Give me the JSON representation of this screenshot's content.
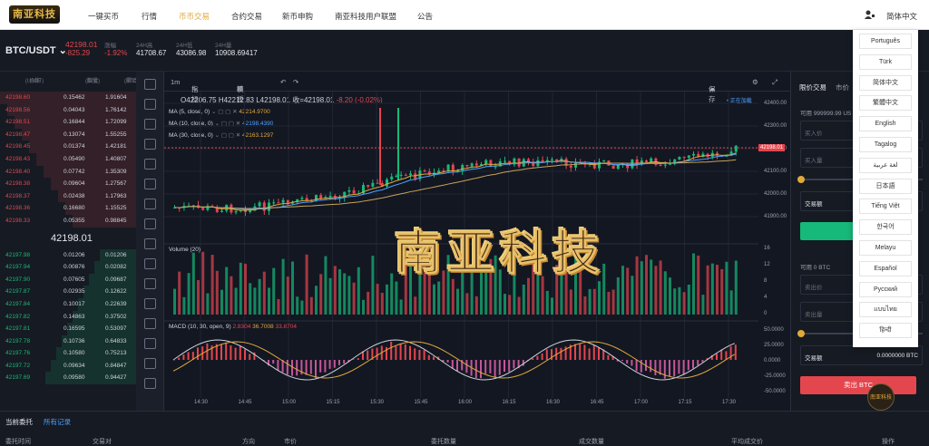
{
  "nav": {
    "logo": "南亚科技",
    "items": [
      "一键买币",
      "行情",
      "币币交易",
      "合约交易",
      "新币申购",
      "南亚科技用户联盟",
      "公告"
    ],
    "active_index": 2,
    "current_language": "简体中文"
  },
  "ticker": {
    "pair": "BTC/USDT",
    "price": "42198.01",
    "change": "-825.29",
    "pct_label": "涨幅",
    "pct": "-1.92%",
    "high_label": "24H高",
    "high": "41708.67",
    "low_label": "24H低",
    "low": "43086.98",
    "vol_label": "24H量",
    "vol": "10908.69417"
  },
  "orderbook": {
    "headers": [
      [
        "价格",
        "(USDT)"
      ],
      [
        "数量",
        "(BTC)"
      ],
      [
        "累计",
        "(BTC)"
      ]
    ],
    "asks": [
      [
        "42198.60",
        "0.15462",
        "1.91604"
      ],
      [
        "42198.56",
        "0.04043",
        "1.76142"
      ],
      [
        "42198.51",
        "0.16844",
        "1.72099"
      ],
      [
        "42198.47",
        "0.13074",
        "1.55255"
      ],
      [
        "42198.45",
        "0.01374",
        "1.42181"
      ],
      [
        "42198.43",
        "0.05490",
        "1.40807"
      ],
      [
        "42198.40",
        "0.07742",
        "1.35309"
      ],
      [
        "42198.38",
        "0.09604",
        "1.27567"
      ],
      [
        "42198.37",
        "0.02438",
        "1.17963"
      ],
      [
        "42198.36",
        "0.16680",
        "1.15525"
      ],
      [
        "42198.33",
        "0.05355",
        "0.98845"
      ]
    ],
    "mid": "42198.01",
    "bids": [
      [
        "42197.98",
        "0.01206",
        "0.01206"
      ],
      [
        "42197.94",
        "0.00876",
        "0.02082"
      ],
      [
        "42197.90",
        "0.07605",
        "0.09687"
      ],
      [
        "42197.87",
        "0.02935",
        "0.12622"
      ],
      [
        "42197.84",
        "0.10017",
        "0.22639"
      ],
      [
        "42197.82",
        "0.14863",
        "0.37502"
      ],
      [
        "42197.81",
        "0.16595",
        "0.53097"
      ],
      [
        "42197.78",
        "0.10736",
        "0.64833"
      ],
      [
        "42197.76",
        "0.10580",
        "0.75213"
      ],
      [
        "42197.72",
        "0.09634",
        "0.84847"
      ],
      [
        "42197.69",
        "0.09580",
        "0.94427"
      ]
    ]
  },
  "chart": {
    "toolbar": {
      "interval": "1m",
      "indicators": "指标",
      "template": "模板",
      "save": "保存"
    },
    "ohlc": {
      "o": "O42206.75",
      "h": "H42212.83",
      "l": "L42198.01",
      "c": "收=42198.01",
      "chg": "-8.20 (-0.02%)"
    },
    "live": "• 正在加载",
    "ma": [
      {
        "label": "MA (5, close, 0)",
        "value": "42214.9700",
        "color": "#e0a93a"
      },
      {
        "label": "MA (10, close, 0)",
        "value": "42198.4390",
        "color": "#4ea1ff"
      },
      {
        "label": "MA (30, close, 0)",
        "value": "42163.1297",
        "color": "#e0a93a"
      }
    ],
    "volume_label": "Volume (20)",
    "macd_label": "MACD (10, 30, open, 9)",
    "macd_values": [
      "2.8304",
      "36.7008",
      "33.8704"
    ],
    "price_ticks": [
      "42400.00",
      "42300.00",
      "42200.00",
      "42100.00",
      "42000.00",
      "41900.00"
    ],
    "current_price_tag": "42198.01",
    "vol_ticks": [
      "16",
      "12",
      "8",
      "4",
      "0"
    ],
    "macd_ticks": [
      "50.0000",
      "25.0000",
      "0.0000",
      "-25.0000",
      "-50.0000"
    ],
    "time_ticks": [
      "14:30",
      "14:45",
      "15:00",
      "15:15",
      "15:30",
      "15:45",
      "16:00",
      "16:15",
      "16:30",
      "16:45",
      "17:00",
      "17:15",
      "17:30"
    ],
    "watermark": "南亚科技"
  },
  "trade": {
    "tabs": [
      "限价交易",
      "市价"
    ],
    "available_label": "可用",
    "available": "999999.99 US",
    "buy_price": "买入价",
    "buy_amount": "买入量",
    "volume_label": "交易额",
    "buy_btn": "买",
    "available2": "可用  0 BTC",
    "sell_price": "卖出价",
    "sell_amount": "卖出量",
    "sell_volume_label": "交易额",
    "sell_volume": "0.0000000 BTC",
    "sell_btn": "卖出 BTC"
  },
  "languages": [
    "Português",
    "Türk",
    "简体中文",
    "繁體中文",
    "English",
    "Tagalog",
    "لغة عربية",
    "日本語",
    "Tiếng Việt",
    "한국어",
    "Melayu",
    "Español",
    "Русский",
    "แบบไทย",
    "हिन्दी"
  ],
  "bottom": {
    "tabs": [
      "当前委托",
      "所有记录"
    ],
    "columns": [
      "委托时间",
      "交易对",
      "方向",
      "市价",
      "委托数量",
      "成交数量",
      "平均成交价",
      "操作"
    ]
  },
  "badge": "南亚科技",
  "colors": {
    "up": "#16b979",
    "down": "#e4464e",
    "accent": "#e0a93a"
  }
}
